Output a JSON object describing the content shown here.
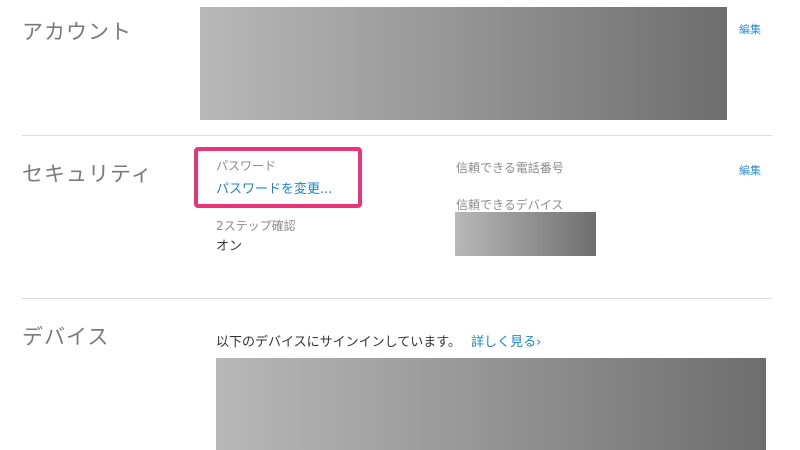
{
  "account": {
    "title": "アカウント",
    "edit_label": "編集"
  },
  "security": {
    "title": "セキュリティ",
    "password_label": "パスワード",
    "change_password_link": "パスワードを変更...",
    "two_step_label": "2ステップ確認",
    "two_step_value": "オン",
    "trusted_phone_label": "信頼できる電話番号",
    "trusted_device_label": "信頼できるデバイス",
    "edit_label": "編集"
  },
  "devices": {
    "title": "デバイス",
    "signed_in_text": "以下のデバイスにサインインしています。",
    "learn_more_link": "詳しく見る",
    "learn_more_chevron": "›"
  },
  "colors": {
    "link": "#1a86d0",
    "highlight": "#e8357a",
    "section_title": "#7a7a7a"
  }
}
